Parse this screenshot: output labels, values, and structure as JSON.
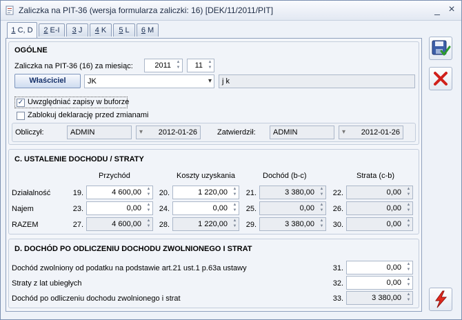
{
  "window": {
    "title": "Zaliczka na PIT-36 (wersja formularza zaliczki: 16) [DEK/11/2011/PIT]",
    "minimize": "_",
    "close": "×"
  },
  "tabs": [
    {
      "hot": "1",
      "rest": " C, D"
    },
    {
      "hot": "2",
      "rest": " E-I"
    },
    {
      "hot": "3",
      "rest": " J"
    },
    {
      "hot": "4",
      "rest": " K"
    },
    {
      "hot": "5",
      "rest": " L"
    },
    {
      "hot": "6",
      "rest": " M"
    }
  ],
  "ogolne": {
    "title": "OGÓLNE",
    "month_label": "Zaliczka na PIT-36 (16) za miesiąc:",
    "year": "2011",
    "month": "11",
    "owner_button": "Właściciel",
    "owner_code": "JK",
    "owner_name": "j k",
    "buffer_label": "Uwzględniać zapisy w buforze",
    "buffer_checked": "✓",
    "lock_label": "Zablokuj deklarację przed zmianami",
    "computed_label": "Obliczył:",
    "computed_user": "ADMIN",
    "computed_date": "2012-01-26",
    "approved_label": "Zatwierdził:",
    "approved_user": "ADMIN",
    "approved_date": "2012-01-26"
  },
  "section_c": {
    "title": "C. USTALENIE DOCHODU / STRATY",
    "headers": [
      "Przychód",
      "Koszty uzyskania",
      "Dochód (b-c)",
      "Strata (c-b)"
    ],
    "rows": [
      {
        "label": "Działalność",
        "cells": [
          {
            "num": "19.",
            "value": "4 600,00"
          },
          {
            "num": "20.",
            "value": "1 220,00"
          },
          {
            "num": "21.",
            "value": "3 380,00"
          },
          {
            "num": "22.",
            "value": "0,00"
          }
        ]
      },
      {
        "label": "Najem",
        "cells": [
          {
            "num": "23.",
            "value": "0,00"
          },
          {
            "num": "24.",
            "value": "0,00"
          },
          {
            "num": "25.",
            "value": "0,00"
          },
          {
            "num": "26.",
            "value": "0,00"
          }
        ]
      },
      {
        "label": "RAZEM",
        "cells": [
          {
            "num": "27.",
            "value": "4 600,00"
          },
          {
            "num": "28.",
            "value": "1 220,00"
          },
          {
            "num": "29.",
            "value": "3 380,00"
          },
          {
            "num": "30.",
            "value": "0,00"
          }
        ]
      }
    ]
  },
  "section_d": {
    "title": "D. DOCHÓD PO ODLICZENIU DOCHODU ZWOLNIONEGO I STRAT",
    "rows": [
      {
        "label": "Dochód zwolniony od podatku na podstawie art.21 ust.1 p.63a ustawy",
        "num": "31.",
        "value": "0,00"
      },
      {
        "label": "Straty z lat ubiegłych",
        "num": "32.",
        "value": "0,00"
      },
      {
        "label": "Dochód po odliczeniu dochodu zwolnionego i strat",
        "num": "33.",
        "value": "3 380,00"
      }
    ]
  },
  "icons": {
    "save": "save-icon",
    "cancel": "cancel-icon",
    "calculate": "lightning-icon",
    "spin_up": "▲",
    "spin_down": "▼",
    "dropdown": "▾"
  }
}
